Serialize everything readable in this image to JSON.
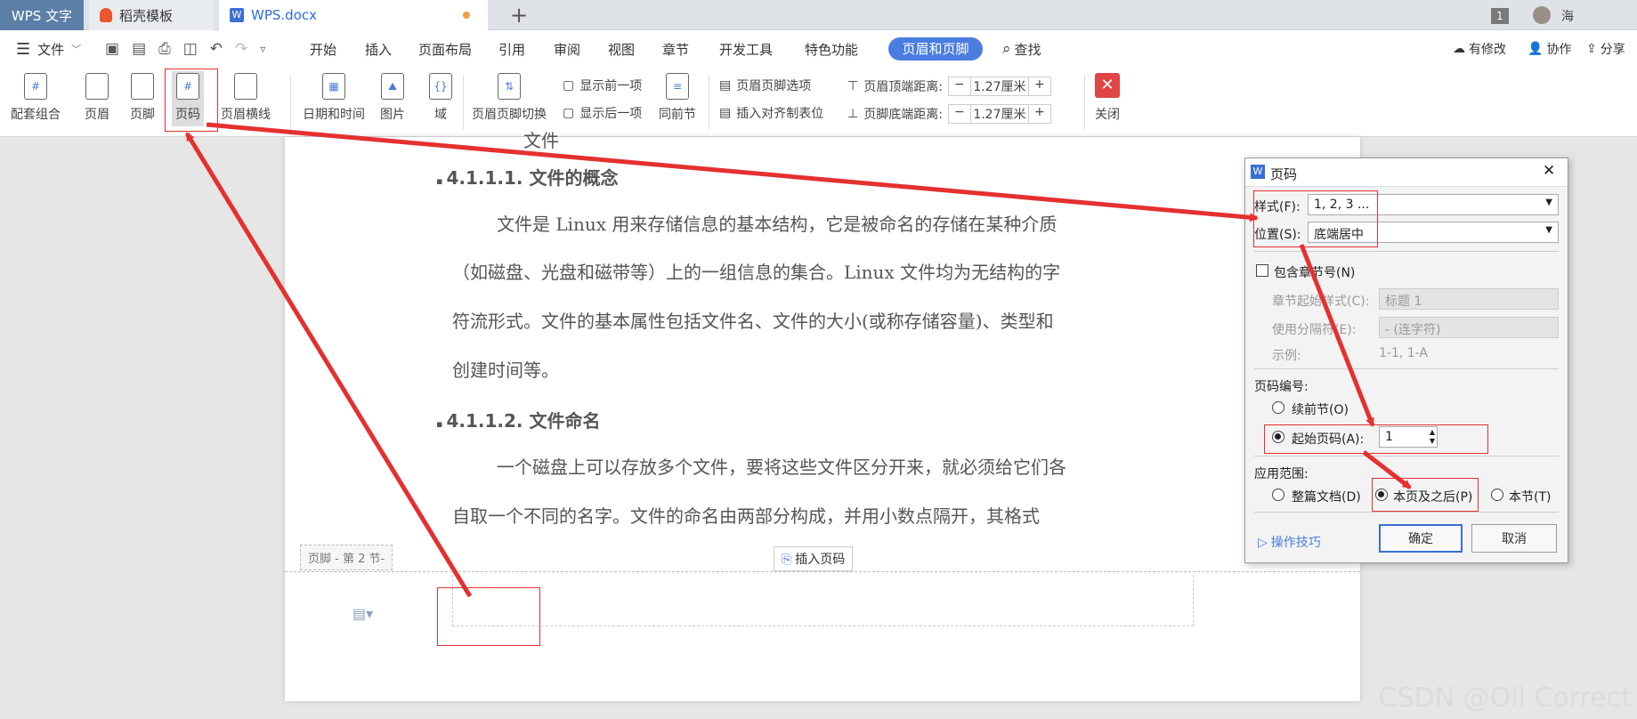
{
  "tabs": {
    "app": "WPS 文字",
    "docer": "稻壳模板",
    "doc": "WPS.docx",
    "add": "+",
    "badge": "1",
    "user": "海"
  },
  "menu": {
    "file": "文件",
    "items": [
      "开始",
      "插入",
      "页面布局",
      "引用",
      "审阅",
      "视图",
      "章节",
      "开发工具",
      "特色功能"
    ],
    "active": "页眉和页脚",
    "search": "查找",
    "right": [
      "有修改",
      "协作",
      "分享"
    ]
  },
  "ribbon": {
    "combo": "配套组合",
    "header": "页眉",
    "footer": "页脚",
    "pagenum": "页码",
    "hline": "页眉横线",
    "datetime": "日期和时间",
    "picture": "图片",
    "field": "域",
    "switch": "页眉页脚切换",
    "prev": "显示前一项",
    "next": "显示后一项",
    "samesec": "同前节",
    "options": "页眉页脚选项",
    "aligntab": "插入对齐制表位",
    "top_dist_label": "页眉顶端距离:",
    "top_dist_value": "1.27厘米",
    "bottom_dist_label": "页脚底端距离:",
    "bottom_dist_value": "1.27厘米",
    "minus": "−",
    "plus": "+",
    "close": "关闭"
  },
  "document": {
    "partial_top": "文件",
    "h1": "4.1.1.1. 文件的概念",
    "p1": [
      "文件是 Linux 用来存储信息的基本结构，它是被命名的存储在某种介质",
      "（如磁盘、光盘和磁带等）上的一组信息的集合。Linux 文件均为无结构的字",
      "符流形式。文件的基本属性包括文件名、文件的大小(或称存储容量)、类型和",
      "创建时间等。"
    ],
    "h2": "4.1.1.2. 文件命名",
    "p2": [
      "一个磁盘上可以存放多个文件，要将这些文件区分开来，就必须给它们各",
      "自取一个不同的名字。文件的命名由两部分构成，并用小数点隔开，其格式"
    ],
    "footer_tag": "页脚 - 第 2 节-",
    "insert_pagenum": "插入页码"
  },
  "dialog": {
    "title": "页码",
    "style_label": "样式(F):",
    "style_value": "1, 2, 3 ...",
    "position_label": "位置(S):",
    "position_value": "底端居中",
    "include_chapter": "包含章节号(N)",
    "chapter_style_label": "章节起始样式(C):",
    "chapter_style_value": "标题 1",
    "separator_label": "使用分隔符(E):",
    "separator_value": "-  (连字符)",
    "example_label": "示例:",
    "example_value": "1-1, 1-A",
    "numbering_title": "页码编号:",
    "continue": "续前节(O)",
    "start_at": "起始页码(A):",
    "start_value": "1",
    "scope_title": "应用范围:",
    "scope_whole": "整篇文档(D)",
    "scope_after": "本页及之后(P)",
    "scope_section": "本节(T)",
    "tips": "操作技巧",
    "ok": "确定",
    "cancel": "取消",
    "close_x": "✕"
  },
  "watermark": "CSDN @Oll Correct",
  "colors": {
    "accent": "#4a7de0",
    "annotation": "#e53030"
  }
}
